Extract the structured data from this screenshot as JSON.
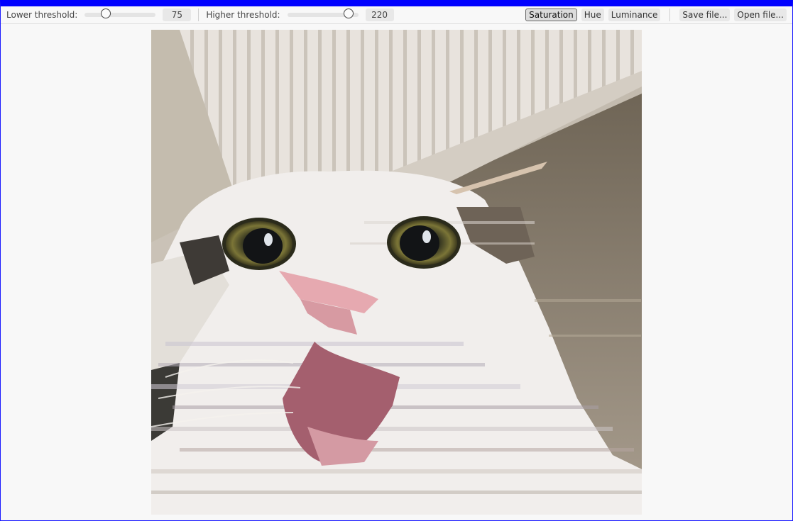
{
  "toolbar": {
    "lower": {
      "label": "Lower threshold:",
      "value": "75",
      "fraction": 0.294
    },
    "higher": {
      "label": "Higher threshold:",
      "value": "220",
      "fraction": 0.863
    },
    "buttons": {
      "saturation": "Saturation",
      "hue": "Hue",
      "luminance": "Luminance",
      "save": "Save file...",
      "open": "Open file..."
    },
    "active_mode": "saturation"
  },
  "image": {
    "subject": "pixel-sorted cat photo",
    "colors": {
      "wall": "#d8d2c9",
      "radiator": "#e6e1db",
      "floor": "#8f8474",
      "fur": "#f2efed",
      "pink": "#e3a6ae",
      "mouth": "#a45f6e",
      "eye": "#6f6a32",
      "pupil": "#121416"
    }
  }
}
